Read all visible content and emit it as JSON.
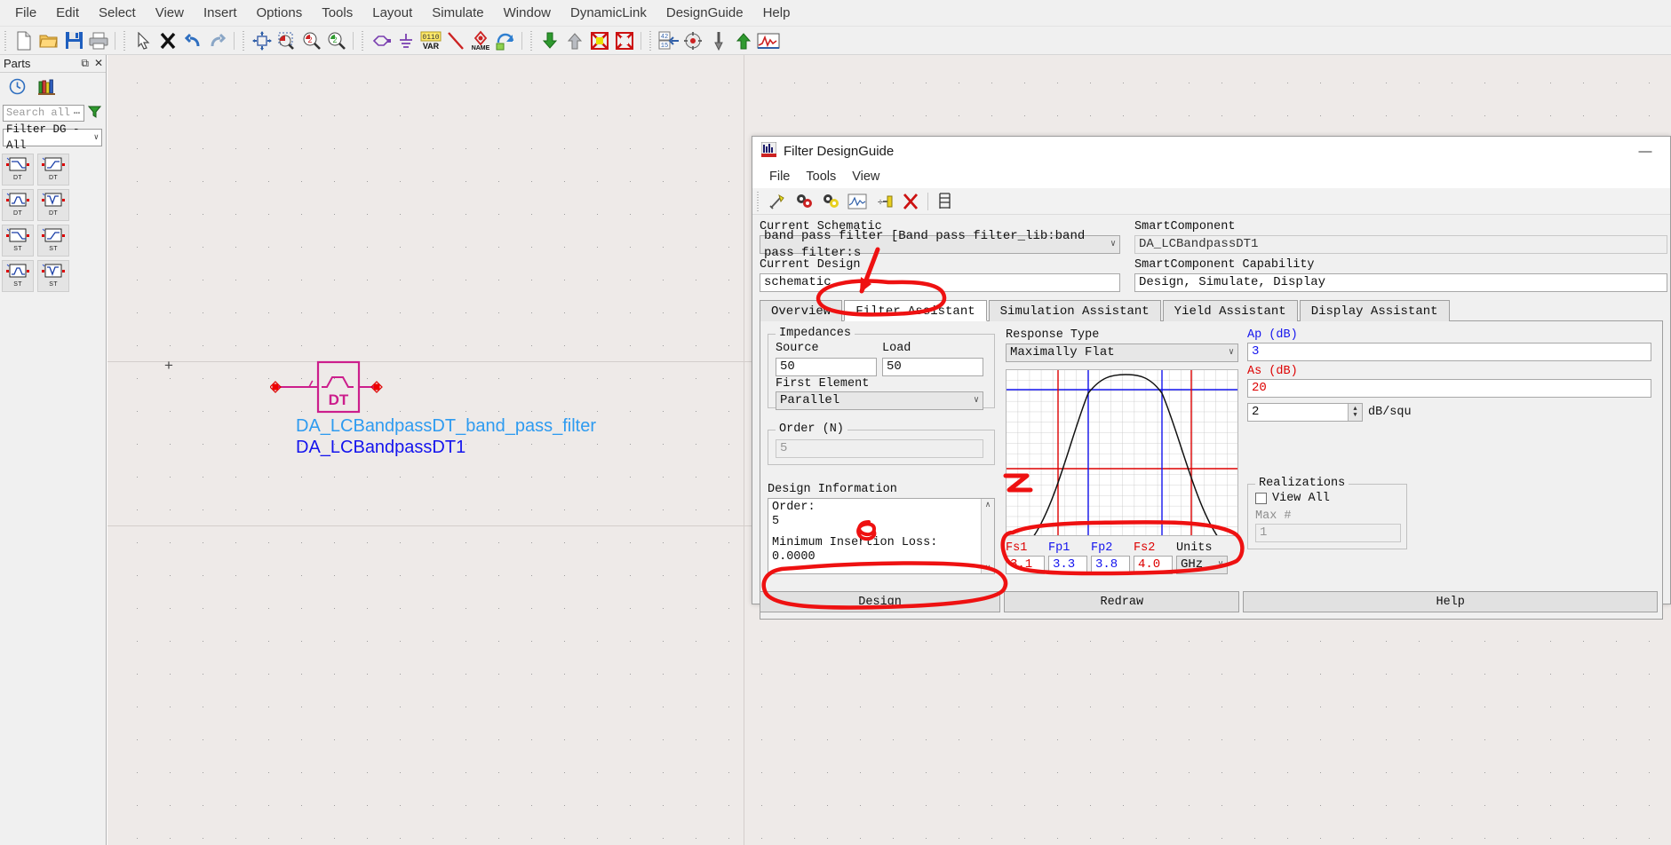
{
  "app": {
    "menu": [
      "File",
      "Edit",
      "Select",
      "View",
      "Insert",
      "Options",
      "Tools",
      "Layout",
      "Simulate",
      "Window",
      "DynamicLink",
      "DesignGuide",
      "Help"
    ],
    "toolbar_groups": [
      {
        "icons": [
          "new-file-icon",
          "open-folder-icon",
          "save-icon",
          "print-icon"
        ]
      },
      {
        "icons": [
          "select-arrow-icon",
          "delete-x-icon",
          "undo-icon",
          "redo-icon"
        ]
      },
      {
        "icons": [
          "zoom-fit-icon",
          "zoom-area-icon",
          "zoom-in-icon",
          "zoom-out-icon"
        ]
      },
      {
        "icons": [
          "component-pin-icon",
          "ground-icon",
          "var-icon",
          "wire-icon",
          "name-icon",
          "rotate-icon"
        ]
      },
      {
        "icons": [
          "push-into-icon",
          "pop-out-icon",
          "deactivate-icon",
          "activate-icon"
        ]
      },
      {
        "icons": [
          "tune-icon",
          "optimize-icon",
          "probe-icon",
          "sim-up-icon",
          "simulate-icon"
        ]
      }
    ]
  },
  "parts": {
    "title": "Parts",
    "title_icons": [
      "restore-icon",
      "close-icon"
    ],
    "toolbar_icons": [
      "history-clock-icon",
      "library-icon"
    ],
    "search": {
      "value": "",
      "placeholder": "Search all",
      "ellipsis": "⋯"
    },
    "filter_icon": "funnel-icon",
    "category": {
      "value": "Filter DG - All",
      "chevron": "∨"
    },
    "items": [
      {
        "label": "DT",
        "shape": "lowpass"
      },
      {
        "label": "DT",
        "shape": "highpass"
      },
      {
        "label": "DT",
        "shape": "bandpass"
      },
      {
        "label": "DT",
        "shape": "bandstop"
      },
      {
        "label": "ST",
        "shape": "lowpass"
      },
      {
        "label": "ST",
        "shape": "highpass"
      },
      {
        "label": "ST",
        "shape": "bandpass"
      },
      {
        "label": "ST",
        "shape": "bandstop"
      }
    ]
  },
  "canvas": {
    "origin_marker": "+",
    "symbol": {
      "tag": "DT",
      "shape": "bandpass"
    },
    "label_instance_type": "DA_LCBandpassDT_band_pass_filter",
    "label_instance_name": "DA_LCBandpassDT1",
    "colors": {
      "symbol": "#cc1e8c",
      "type_label": "#2e9bf0",
      "name_label": "#1414ee",
      "pin": "#ee0000"
    }
  },
  "dialog": {
    "icon": "filter-dg-icon",
    "title": "Filter DesignGuide",
    "minimize": "—",
    "menu": [
      "File",
      "Tools",
      "View"
    ],
    "toolbar_icons": [
      "design-wand-icon",
      "sim-gears-red-icon",
      "sim-gears-yellow-icon",
      "plot-icon",
      "divide-icon",
      "delete-red-x-icon",
      "table-icon"
    ],
    "current_schematic": {
      "label": "Current Schematic",
      "value": "band pass filter [Band pass filter_lib:band pass filter:s",
      "chevron": "∨"
    },
    "current_design": {
      "label": "Current Design",
      "value": "schematic"
    },
    "smartcomponent": {
      "label": "SmartComponent",
      "value": "DA_LCBandpassDT1"
    },
    "smartcomponent_capability": {
      "label": "SmartComponent Capability",
      "value": "Design, Simulate, Display"
    },
    "tabs": [
      {
        "label": "Overview",
        "active": false
      },
      {
        "label": "Filter Assistant",
        "active": true
      },
      {
        "label": "Simulation Assistant",
        "active": false
      },
      {
        "label": "Yield Assistant",
        "active": false
      },
      {
        "label": "Display Assistant",
        "active": false
      }
    ],
    "impedances": {
      "group_label": "Impedances",
      "source_label": "Source",
      "source_value": "50",
      "load_label": "Load",
      "load_value": "50",
      "first_element_label": "First Element",
      "first_element_value": "Parallel",
      "chevron": "∨"
    },
    "order": {
      "group_label": "Order (N)",
      "value": "5"
    },
    "design_information": {
      "label": "Design Information",
      "lines": [
        "Order:",
        "5",
        "",
        "Minimum Insertion Loss:",
        "0.0000"
      ],
      "scroll_up": "∧",
      "scroll_down": "∨"
    },
    "response_type": {
      "label": "Response Type",
      "value": "Maximally Flat",
      "chevron": "∨"
    },
    "ap": {
      "label": "Ap (dB)",
      "value": "3",
      "color": "#1414ee"
    },
    "as": {
      "label": "As (dB)",
      "value": "20",
      "color": "#dd0000"
    },
    "slope": {
      "value": "2",
      "units": "dB/squ"
    },
    "realizations": {
      "group_label": "Realizations",
      "view_all_label": "View All",
      "view_all_checked": false,
      "max_label": "Max #",
      "max_value": "1"
    },
    "frequencies": [
      {
        "name": "Fs1",
        "value": "3.1",
        "color": "#dd0000"
      },
      {
        "name": "Fp1",
        "value": "3.3",
        "color": "#1414ee"
      },
      {
        "name": "Fp2",
        "value": "3.8",
        "color": "#1414ee"
      },
      {
        "name": "Fs2",
        "value": "4.0",
        "color": "#dd0000"
      }
    ],
    "units": {
      "label": "Units",
      "value": "GHz",
      "chevron": "∨"
    },
    "buttons": [
      {
        "label": "Design",
        "name": "design-button"
      },
      {
        "label": "Redraw",
        "name": "redraw-button"
      },
      {
        "label": "Help",
        "name": "help-button"
      }
    ]
  },
  "annotations": {
    "color": "#ee1111",
    "marks": [
      "arrow-to-filter-assistant-tab",
      "circle-filter-assistant-tab",
      "circle-minimum-insertion-loss",
      "numeral-2-near-graph",
      "circle-frequency-inputs",
      "circle-design-button"
    ]
  }
}
